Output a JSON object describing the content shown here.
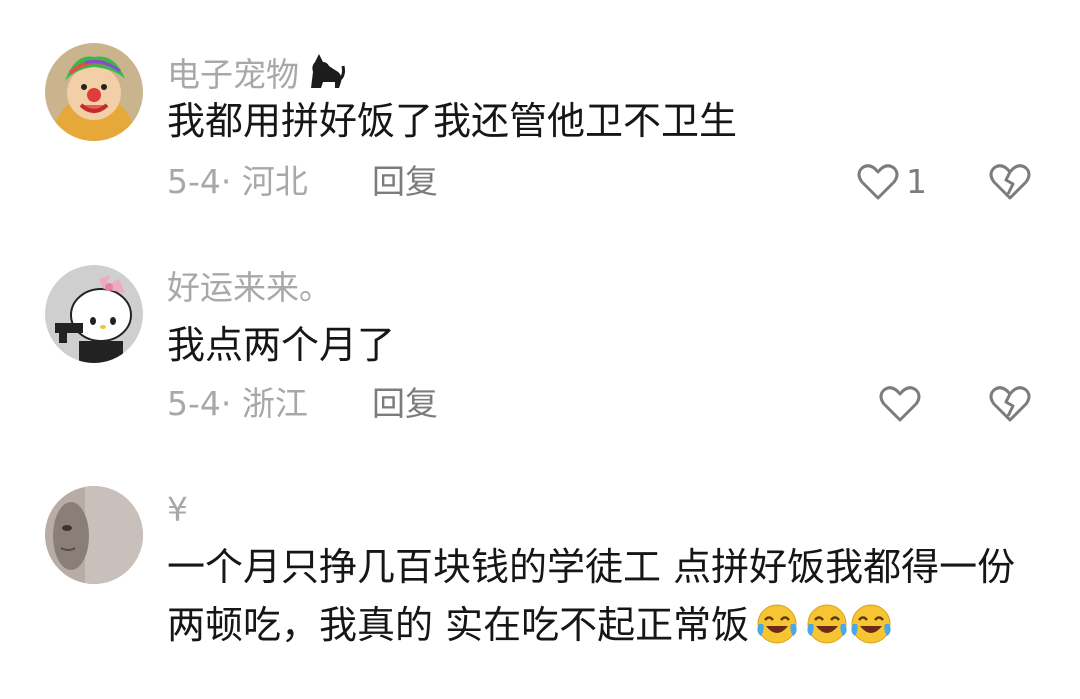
{
  "comments": [
    {
      "username": "电子宠物",
      "username_icon": "black-cat-icon",
      "text": "我都用拼好饭了我还管他卫不卫生",
      "date_location": "5-4· 河北",
      "reply_label": "回复",
      "like_count": "1"
    },
    {
      "username": "好运来来。",
      "text": "我点两个月了",
      "date_location": "5-4· 浙江",
      "reply_label": "回复",
      "like_count": ""
    },
    {
      "username": "¥",
      "text": "一个月只挣几百块钱的学徒工 点拼好饭我都得一份两顿吃，我真的 实在吃不起正常饭",
      "trailing_emojis": [
        "laughing-crying-icon",
        "laughing-crying-icon",
        "laughing-crying-icon"
      ]
    }
  ],
  "colors": {
    "username": "#a8a8a8",
    "text": "#161616",
    "meta": "#a8a8a8",
    "action": "#7c7c7c"
  }
}
